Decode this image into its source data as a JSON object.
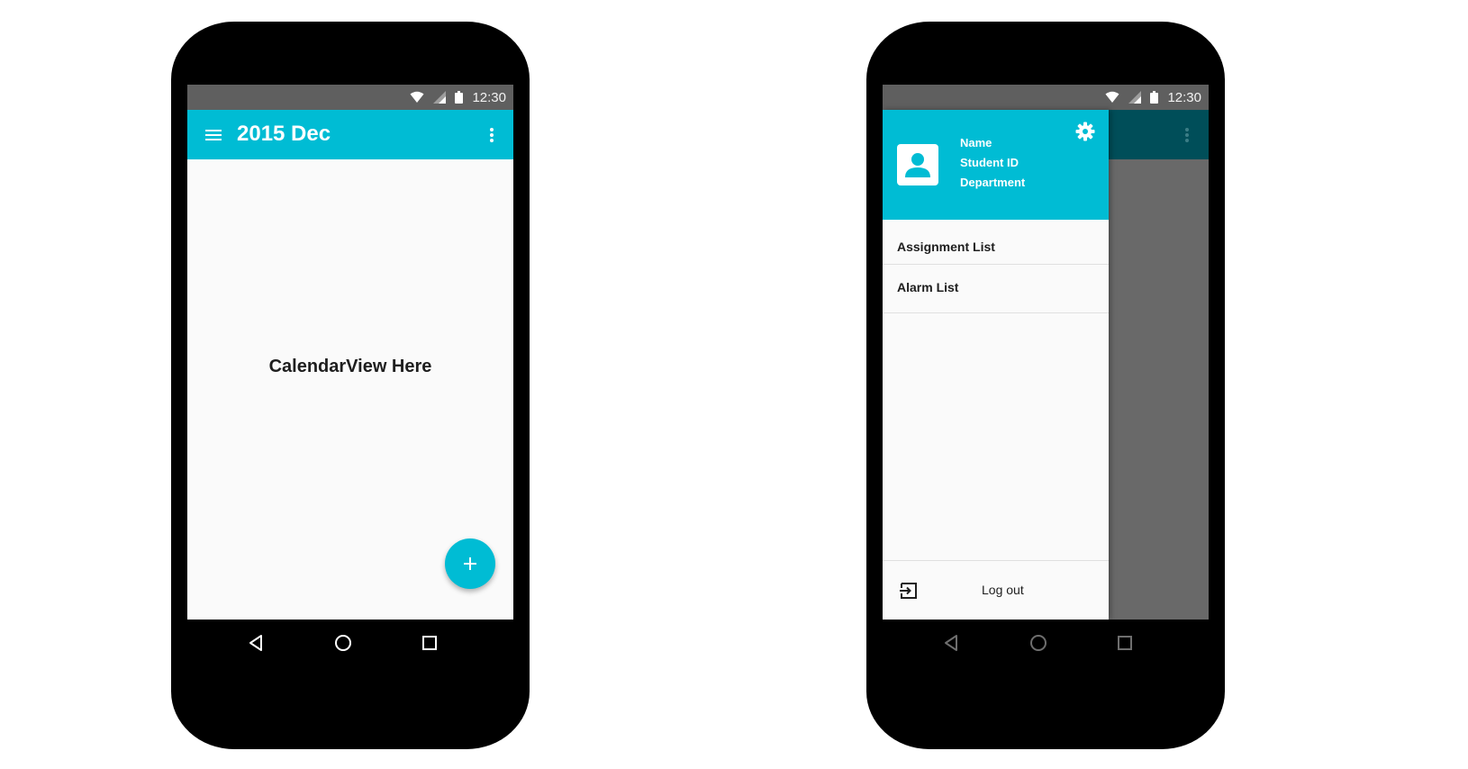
{
  "left_phone": {
    "status_bar": {
      "time": "12:30",
      "icons": [
        "wifi-icon",
        "signal-icon",
        "battery-icon"
      ]
    },
    "app_bar": {
      "title": "2015 Dec",
      "menu_icon": "hamburger-menu-icon",
      "overflow_icon": "more-vert-icon"
    },
    "content": {
      "placeholder_text": "CalendarView Here"
    },
    "fab": {
      "icon": "plus-icon"
    },
    "navigation_bar": {
      "buttons": [
        "back-icon",
        "home-icon",
        "recents-icon"
      ]
    }
  },
  "right_phone": {
    "status_bar": {
      "time": "12:30",
      "icons": [
        "wifi-icon",
        "signal-icon",
        "battery-icon"
      ]
    },
    "drawer": {
      "header": {
        "avatar_icon": "account-box-icon",
        "settings_icon": "gear-icon",
        "name": "Name",
        "student_id": "Student ID",
        "department": "Department"
      },
      "items": [
        {
          "label": "Assignment List"
        },
        {
          "label": "Alarm List"
        }
      ],
      "footer": {
        "icon": "exit-to-app-icon",
        "label": "Log out"
      }
    },
    "navigation_bar": {
      "buttons": [
        "back-icon",
        "home-icon",
        "recents-icon"
      ]
    }
  },
  "colors": {
    "primary": "#00bcd4",
    "primary_dimmed": "#004e59",
    "status_bar": "#5f5f5f",
    "scrim": "#696969",
    "background": "#fafafa",
    "device": "#000000"
  }
}
